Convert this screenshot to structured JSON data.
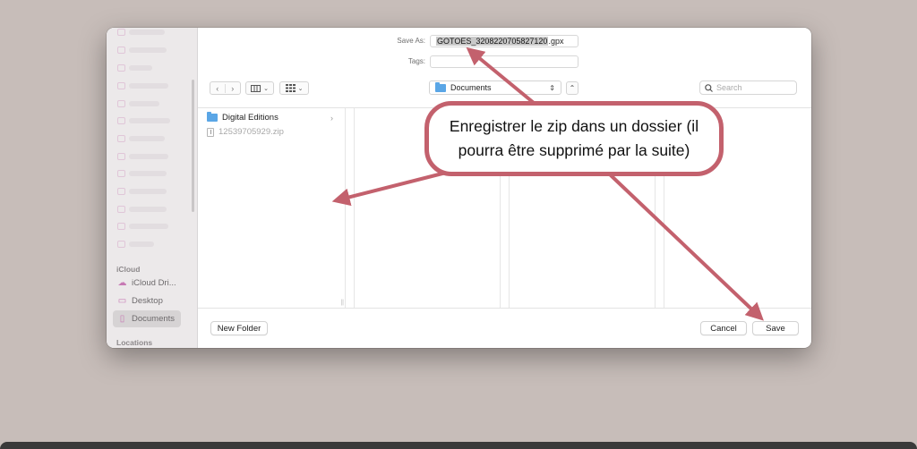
{
  "dialog": {
    "save_as_label": "Save As:",
    "filename_selected": "GOTOES_3208220705827120",
    "filename_ext": ".gpx",
    "tags_label": "Tags:",
    "tags_value": "",
    "location": "Documents",
    "search_placeholder": "Search",
    "new_folder_label": "New Folder",
    "cancel_label": "Cancel",
    "save_label": "Save"
  },
  "sidebar": {
    "icloud_heading": "iCloud",
    "items": [
      {
        "label": "iCloud Dri...",
        "icon": "cloud-icon"
      },
      {
        "label": "Desktop",
        "icon": "desktop-icon"
      },
      {
        "label": "Documents",
        "icon": "document-icon",
        "active": true
      }
    ],
    "locations_heading": "Locations"
  },
  "files": [
    {
      "name": "Digital Editions",
      "type": "folder",
      "has_children": true
    },
    {
      "name": "12539705929.zip",
      "type": "zip",
      "dimmed": true
    }
  ],
  "annotation": {
    "text": "Enregistrer le zip dans un dossier (il pourra être supprimé par la suite)",
    "color": "#c3616d"
  }
}
